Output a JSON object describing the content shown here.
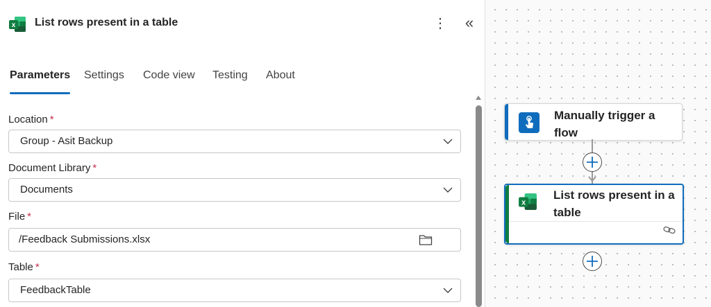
{
  "panel": {
    "title": "List rows present in a table",
    "icons": {
      "app": "excel-icon",
      "more": "more-vertical-icon",
      "collapse": "double-chevron-left-icon"
    },
    "tabs": [
      {
        "label": "Parameters",
        "active": true
      },
      {
        "label": "Settings",
        "active": false
      },
      {
        "label": "Code view",
        "active": false
      },
      {
        "label": "Testing",
        "active": false
      },
      {
        "label": "About",
        "active": false
      }
    ],
    "fields": {
      "location": {
        "label": "Location",
        "required_mark": "*",
        "value": "Group - Asit Backup"
      },
      "library": {
        "label": "Document Library",
        "required_mark": "*",
        "value": "Documents"
      },
      "file": {
        "label": "File",
        "required_mark": "*",
        "value": "/Feedback Submissions.xlsx"
      },
      "table": {
        "label": "Table",
        "required_mark": "*",
        "value": "FeedbackTable"
      }
    }
  },
  "canvas": {
    "trigger_card": {
      "title": "Manually trigger a flow",
      "icon": "touch-icon"
    },
    "excel_card": {
      "title": "List rows present in a table",
      "icon": "excel-icon",
      "footer_icon": "link-icon"
    },
    "add_button_icon": "plus-icon"
  },
  "colors": {
    "accent_blue": "#0f6cbd",
    "excel_green": "#107c41",
    "required_red": "#c4314b"
  }
}
